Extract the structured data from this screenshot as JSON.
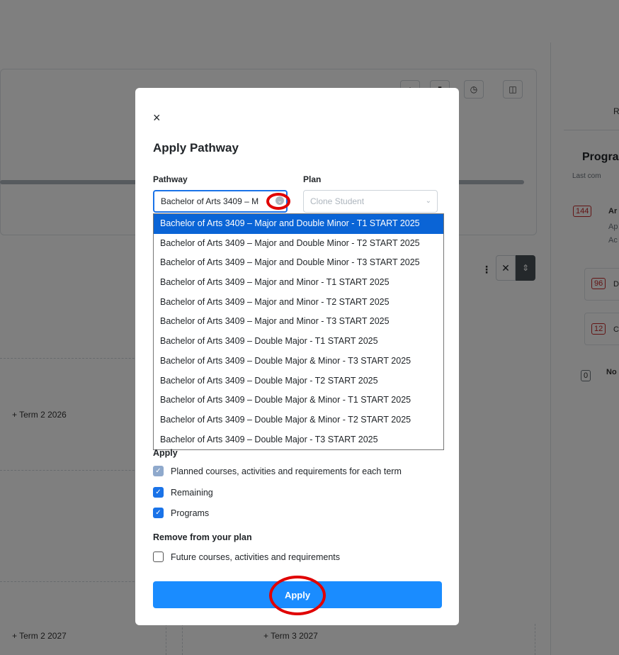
{
  "background": {
    "toolbar_icons": [
      "plus-icon",
      "flag-icon",
      "clock-icon",
      "panel-icon"
    ],
    "terms": [
      "+ Term 2 2026",
      "+ Term 2 2027",
      "+ Term 3 2027"
    ],
    "right_panel": {
      "tab_partial": "R",
      "title_partial": "Progra",
      "subtitle_partial": "Last com",
      "items": [
        {
          "badge": "144",
          "text": "Ar",
          "sub1": "Ap",
          "sub2": "Ac"
        },
        {
          "badge": "96",
          "text": "D"
        },
        {
          "badge": "12",
          "text": "C"
        },
        {
          "badge": "0",
          "text": "No"
        }
      ]
    }
  },
  "modal": {
    "close_icon": "×",
    "title": "Apply Pathway",
    "pathway": {
      "label": "Pathway",
      "value": "Bachelor of Arts 3409 – M",
      "options": [
        "Bachelor of Arts 3409 – Major and Double Minor - T1 START 2025",
        "Bachelor of Arts 3409 – Major and Double Minor - T2 START 2025",
        "Bachelor of Arts 3409 – Major and Double Minor - T3 START 2025",
        "Bachelor of Arts 3409 – Major and Minor - T1 START 2025",
        "Bachelor of Arts 3409 – Major and Minor - T2 START 2025",
        "Bachelor of Arts 3409 – Major and Minor - T3 START 2025",
        "Bachelor of Arts 3409 – Double Major - T1 START 2025",
        "Bachelor of Arts 3409 – Double Major & Minor - T3 START 2025",
        "Bachelor of Arts 3409 – Double Major - T2 START 2025",
        "Bachelor of Arts 3409 – Double Major & Minor - T1 START 2025",
        "Bachelor of Arts 3409 – Double Major & Minor - T2 START 2025",
        "Bachelor of Arts 3409 – Double Major - T3 START 2025"
      ],
      "selected_index": 0
    },
    "plan": {
      "label": "Plan",
      "placeholder": "Clone Student"
    },
    "apply_section": {
      "label": "Apply",
      "items": [
        {
          "label": "Planned courses, activities and requirements for each term",
          "checked": true
        },
        {
          "label": "Remaining",
          "checked": true
        },
        {
          "label": "Programs",
          "checked": true
        }
      ]
    },
    "remove_section": {
      "label": "Remove from your plan",
      "items": [
        {
          "label": "Future courses, activities and requirements",
          "checked": false
        }
      ]
    },
    "apply_button": "Apply",
    "colors": {
      "primary": "#1a8cff",
      "selected_option": "#0a64d6",
      "annotation": "#e00000"
    }
  }
}
